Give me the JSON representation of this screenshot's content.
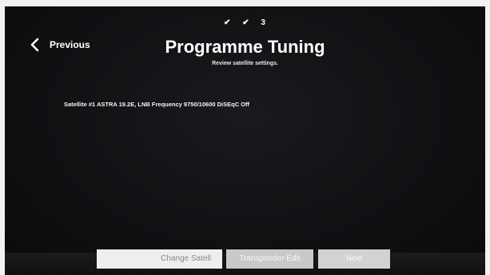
{
  "steps": {
    "step1": "✔",
    "step2": "✔",
    "step3": "3"
  },
  "header": {
    "back_label": "Previous",
    "back_icon": "chevron-left-icon",
    "title": "Programme Tuning",
    "subtitle": "Review satellite settings."
  },
  "main": {
    "satellite_info": "Satellite #1 ASTRA 19.2E, LNB Frequency 9750/10600 DiSEqC Off"
  },
  "buttons": {
    "change_satellite": "Change Satell",
    "transponder_edit": "Transponder Edit",
    "next": "Next"
  }
}
